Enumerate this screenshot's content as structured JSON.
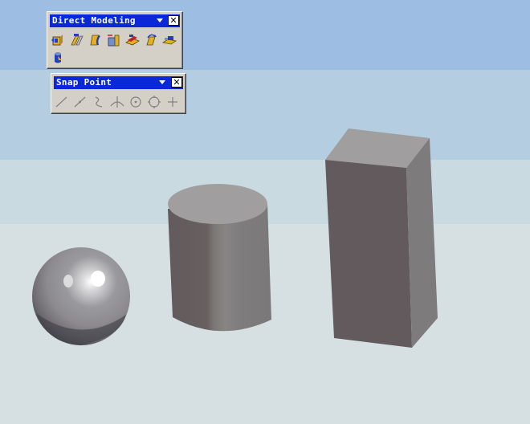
{
  "direct_modeling_toolbar": {
    "title": "Direct Modeling",
    "menu_icon": "chevron-down-icon",
    "close_icon": "close-icon",
    "close_label": "✕",
    "tools": [
      "move-face-icon",
      "offset-face-icon",
      "replace-face-icon",
      "resize-blend-icon",
      "delete-face-icon",
      "rotate-face-icon",
      "resize-face-icon",
      "cylinder-face-icon"
    ]
  },
  "snap_point_toolbar": {
    "title": "Snap Point",
    "menu_icon": "chevron-down-icon",
    "close_icon": "close-icon",
    "close_label": "✕",
    "tools": [
      "end-point-icon",
      "mid-point-icon",
      "control-point-icon",
      "intersection-point-icon",
      "arc-center-icon",
      "quadrant-point-icon",
      "existing-point-icon"
    ]
  },
  "scene": {
    "objects": [
      "sphere",
      "cylinder",
      "block"
    ],
    "colors": {
      "background_top": "#9dbde2",
      "background_band_2": "#b4cde0",
      "background_band_3": "#c9dbe0",
      "background_bottom": "#d6e0e2",
      "solid_dark": "#625a5d",
      "solid_mid": "#7e7b7c",
      "solid_light": "#a09e9f",
      "titlebar": "#0a28d8",
      "toolbar_face": "#d4d0c8"
    }
  }
}
